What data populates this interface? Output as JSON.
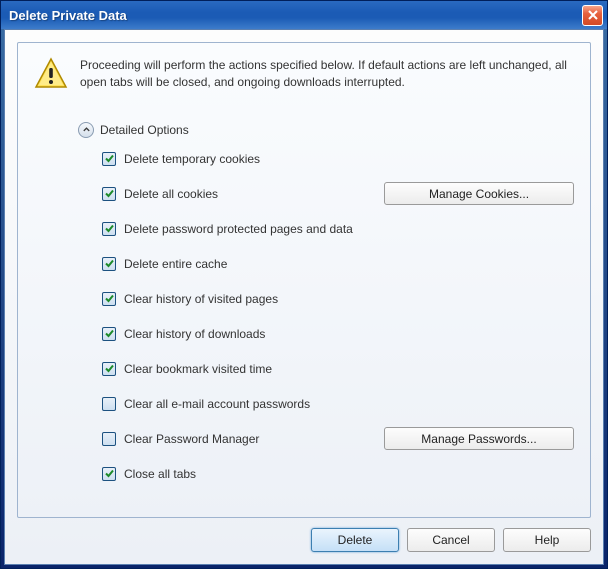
{
  "title": "Delete Private Data",
  "warning": "Proceeding will perform the actions specified below. If default actions are left unchanged, all open tabs will be closed, and ongoing downloads interrupted.",
  "section_label": "Detailed Options",
  "options": {
    "temp_cookies": {
      "label": "Delete temporary cookies",
      "checked": true
    },
    "all_cookies": {
      "label": "Delete all cookies",
      "checked": true
    },
    "pwd_pages": {
      "label": "Delete password protected pages and data",
      "checked": true
    },
    "cache": {
      "label": "Delete entire cache",
      "checked": true
    },
    "history_pages": {
      "label": "Clear history of visited pages",
      "checked": true
    },
    "history_dl": {
      "label": "Clear history of downloads",
      "checked": true
    },
    "bookmark_time": {
      "label": "Clear bookmark visited time",
      "checked": true
    },
    "email_pwd": {
      "label": "Clear all e-mail account passwords",
      "checked": false
    },
    "pwd_mgr": {
      "label": "Clear Password Manager",
      "checked": false
    },
    "close_tabs": {
      "label": "Close all tabs",
      "checked": true
    }
  },
  "side_buttons": {
    "manage_cookies": "Manage Cookies...",
    "manage_passwords": "Manage Passwords..."
  },
  "footer": {
    "delete": "Delete",
    "cancel": "Cancel",
    "help": "Help"
  }
}
